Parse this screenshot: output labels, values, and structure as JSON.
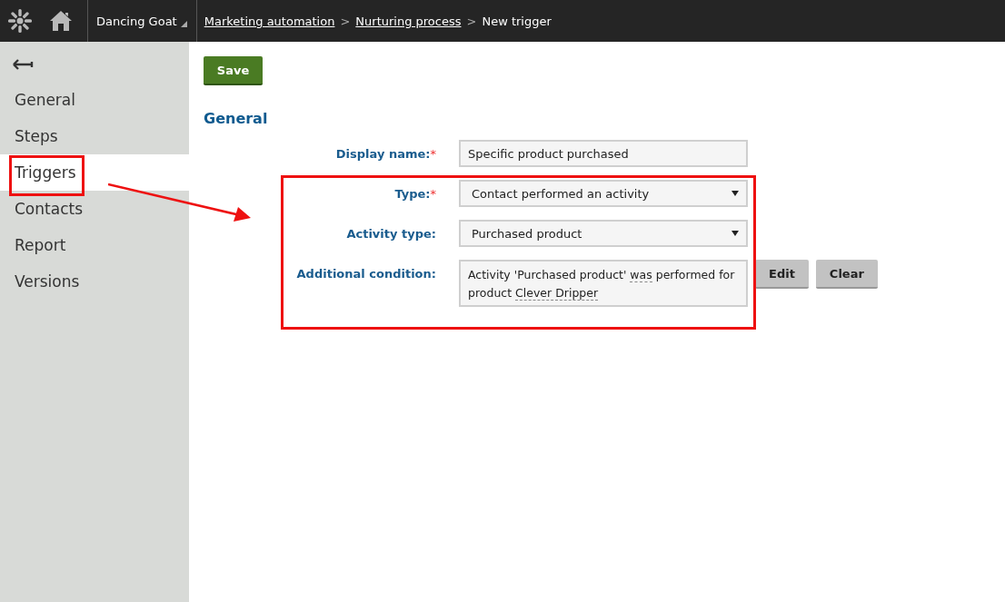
{
  "header": {
    "site": "Dancing Goat",
    "breadcrumbs": [
      {
        "label": "Marketing automation",
        "link": true
      },
      {
        "label": "Nurturing process",
        "link": true
      },
      {
        "label": "New trigger",
        "link": false
      }
    ],
    "separator": ">"
  },
  "sidebar": {
    "items": [
      {
        "label": "General",
        "selected": false
      },
      {
        "label": "Steps",
        "selected": false
      },
      {
        "label": "Triggers",
        "selected": true
      },
      {
        "label": "Contacts",
        "selected": false
      },
      {
        "label": "Report",
        "selected": false
      },
      {
        "label": "Versions",
        "selected": false
      }
    ]
  },
  "toolbar": {
    "save": "Save"
  },
  "section_title": "General",
  "form": [
    {
      "kind": "text",
      "label": "Display name:",
      "required_mark": "*",
      "value": "Specific product purchased"
    },
    {
      "kind": "select",
      "label": "Type:",
      "required_mark": "*",
      "value": "Contact performed an activity"
    },
    {
      "kind": "select",
      "label": "Activity type:",
      "value": "Purchased product"
    },
    {
      "kind": "condition",
      "label": "Additional condition:",
      "segments": [
        {
          "text": "Activity 'Purchased product' ",
          "underlined": false
        },
        {
          "text": "was",
          "underlined": true
        },
        {
          "text": " performed for product ",
          "underlined": false
        },
        {
          "text": "Clever Dripper",
          "underlined": true
        }
      ],
      "buttons": [
        "Edit",
        "Clear"
      ]
    }
  ]
}
